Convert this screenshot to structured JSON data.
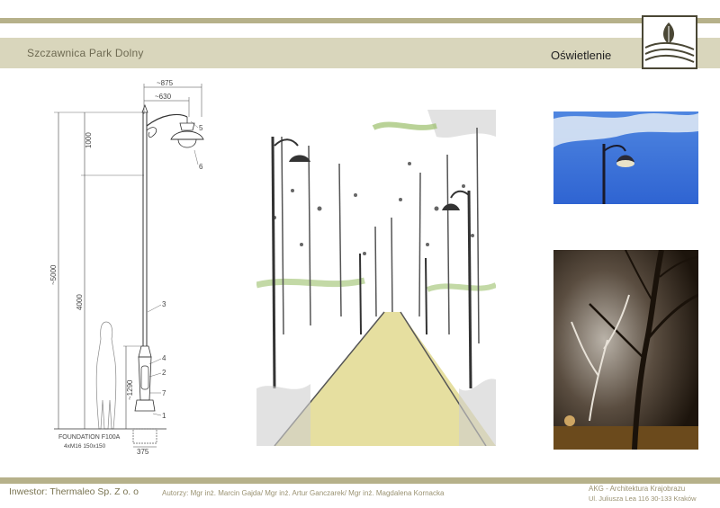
{
  "header": {
    "project_title": "Szczawnica Park Dolny",
    "section_title": "Oświetlenie"
  },
  "drawing": {
    "dims": {
      "total_width": "~875",
      "arm_width": "~630",
      "top_height": "1000",
      "total_height": "~5000",
      "pole_height": "4000",
      "base_height": "~1290",
      "foundation_width": "375"
    },
    "callouts": [
      "5",
      "6",
      "3",
      "4",
      "2",
      "7",
      "1"
    ],
    "foundation_label": "FOUNDATION F100A",
    "foundation_spec": "4xM16  150x150"
  },
  "footer": {
    "investor": "Inwestor: Thermaleo Sp. Z o. o",
    "authors": "Autorzy: Mgr inż. Marcin Gajda/ Mgr inż. Artur Ganczarek/ Mgr inż. Magdalena Kornacka",
    "company": "AKG - Architektura Krajobrazu",
    "address": "Ul. Juliusza Lea 116  30-133 Kraków"
  },
  "colors": {
    "band": "#b6b18a",
    "header_band": "#d9d6bc",
    "logo_stroke": "#4a4735"
  }
}
